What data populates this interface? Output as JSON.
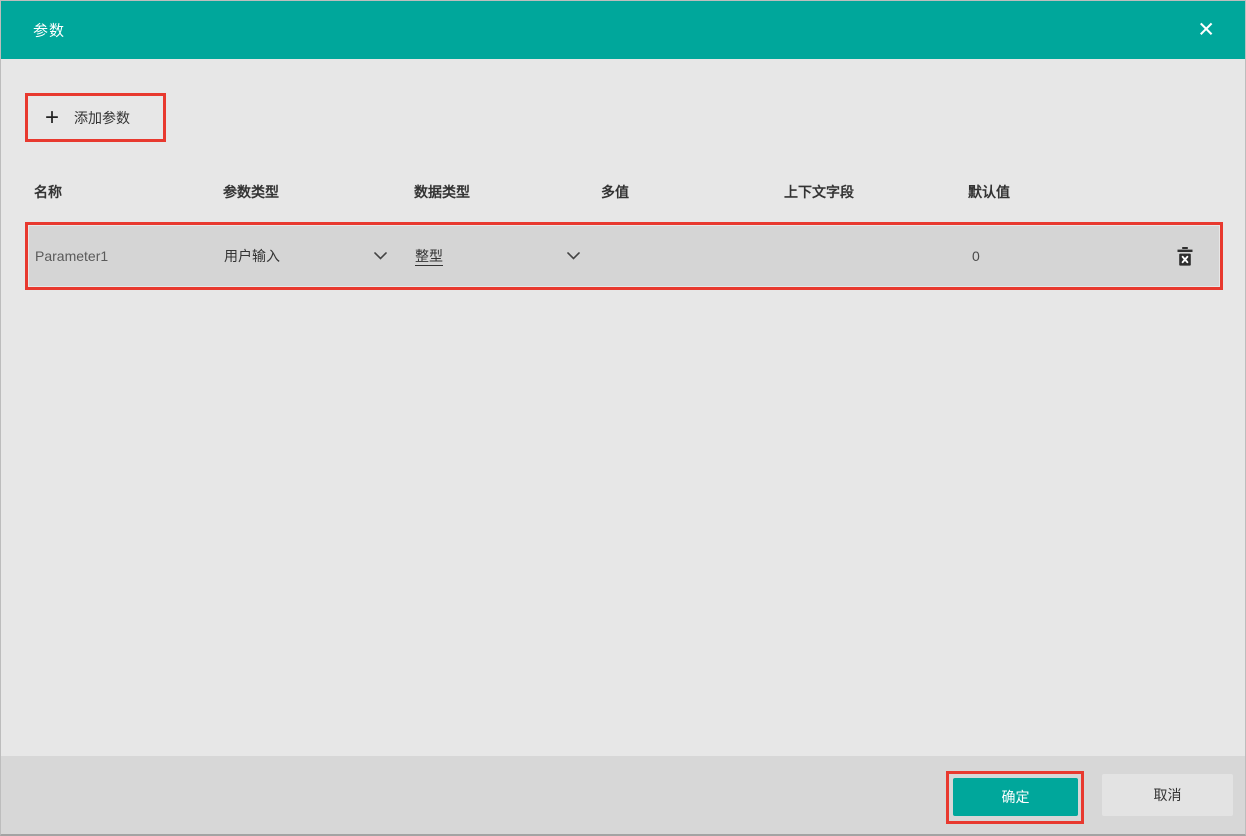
{
  "dialog": {
    "title": "参数"
  },
  "icons": {
    "close": "✕",
    "plus": "+"
  },
  "toolbar": {
    "add_param_label": "添加参数"
  },
  "table": {
    "headers": {
      "name": "名称",
      "param_type": "参数类型",
      "data_type": "数据类型",
      "multi_value": "多值",
      "context_field": "上下文字段",
      "default_value": "默认值"
    },
    "rows": [
      {
        "name": "Parameter1",
        "param_type": "用户输入",
        "data_type": "整型",
        "multi_value_checked": false,
        "context_field": "",
        "default_value": "0"
      }
    ]
  },
  "footer": {
    "ok_label": "确定",
    "cancel_label": "取消"
  },
  "colors": {
    "accent": "#00a79b",
    "highlight_red": "#e8392f",
    "body_bg": "#e7e7e7",
    "footer_bg": "#d7d7d7",
    "row_bg": "#d5d5d5",
    "checkbox_bg": "#c5c5c5"
  }
}
